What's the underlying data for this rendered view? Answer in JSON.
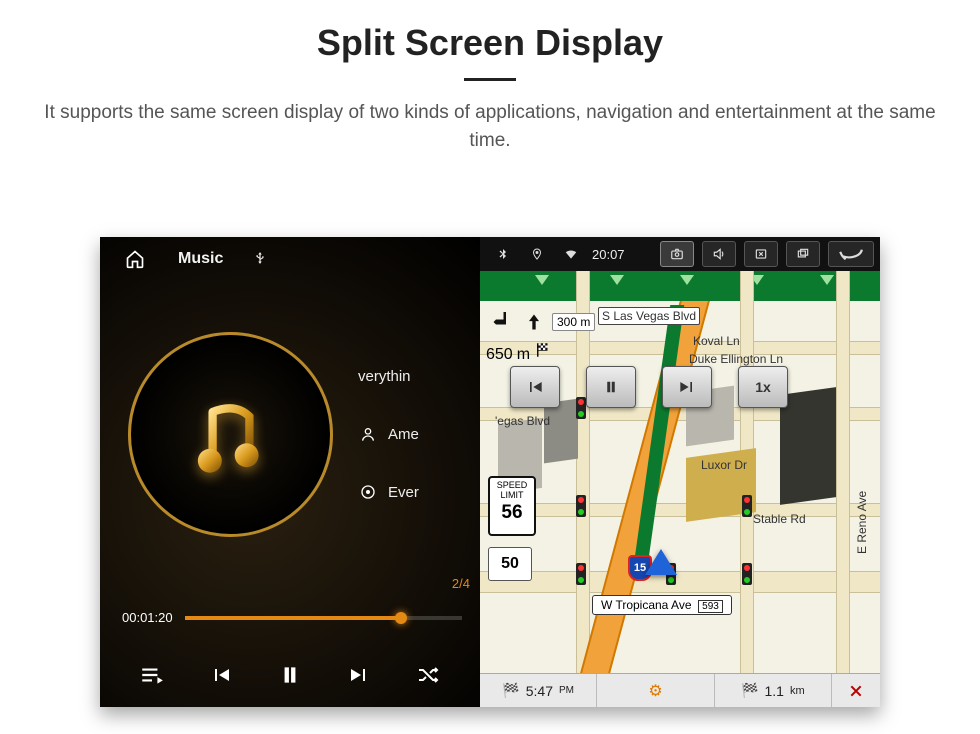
{
  "page": {
    "title": "Split Screen Display",
    "description": "It supports the same screen display of two kinds of applications, navigation and entertainment at the same time."
  },
  "music": {
    "tab_music": "Music",
    "tab_usb_icon": "usb",
    "track_title_partial": "verythin",
    "artist_partial": "Ame",
    "album_partial": "Ever",
    "track_counter": "2/4",
    "elapsed": "00:01:20",
    "progress_percent": 78
  },
  "statusbar": {
    "time": "20:07"
  },
  "nav": {
    "street_main": "S Las Vegas Blvd",
    "street_koval": "Koval Ln",
    "street_duke": "Duke Ellington Ln",
    "street_vegas_blvd": "'egas Blvd",
    "street_luxor": "Luxor Dr",
    "street_stable": "Stable Rd",
    "street_reno": "E Reno Ave",
    "street_tropicana": "W Tropicana Ave",
    "trop_exit": "593",
    "turn_primary_arrow": "left-uturn",
    "turn_primary_dist": "300",
    "turn_primary_unit": "m",
    "turn_secondary_dist": "650",
    "turn_secondary_unit": "m",
    "speed_limit_label_top": "SPEED",
    "speed_limit_label_bot": "LIMIT",
    "speed_limit_value": "56",
    "current_speed": "50",
    "hwy_shield": "15",
    "playback_rate": "1x",
    "bottom_eta": "5:47",
    "bottom_dist": "1.1",
    "bottom_dist_unit": "km"
  }
}
